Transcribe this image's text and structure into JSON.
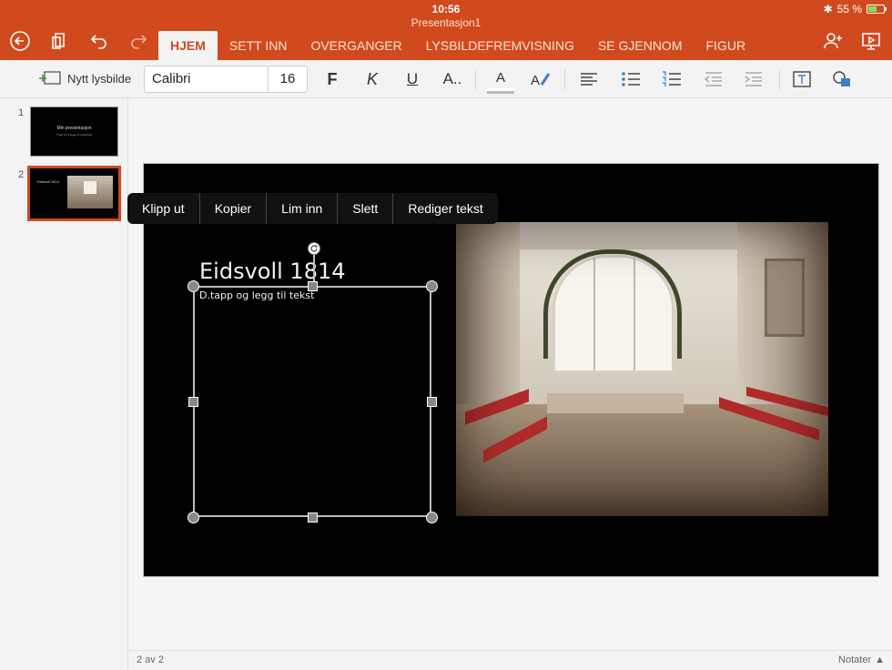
{
  "status": {
    "time": "10:56",
    "battery": "55 %",
    "battery_level": 0.55
  },
  "document": {
    "title": "Presentasjon1"
  },
  "ribbon": {
    "tabs": [
      {
        "label": "HJEM",
        "active": true
      },
      {
        "label": "SETT INN"
      },
      {
        "label": "OVERGANGER"
      },
      {
        "label": "LYSBILDEFREMVISNING"
      },
      {
        "label": "SE GJENNOM"
      },
      {
        "label": "FIGUR"
      }
    ]
  },
  "toolbar": {
    "new_slide_label": "Nytt lysbilde",
    "font_name": "Calibri",
    "font_size": "16",
    "bold_label": "F",
    "italic_label": "K",
    "underline_label": "U",
    "more_format_label": "A..",
    "font_color_label": "A"
  },
  "thumbnails": [
    {
      "number": "1",
      "title": "Min presentasjon",
      "subtitle": "Trykk for å legge til undertittel"
    },
    {
      "number": "2",
      "title": "Eidsvoll 1814"
    }
  ],
  "slide": {
    "title": "Eidsvoll 1814",
    "placeholder": "D.tapp og legg til tekst"
  },
  "context_menu": {
    "items": [
      "Klipp ut",
      "Kopier",
      "Lim inn",
      "Slett",
      "Rediger tekst"
    ]
  },
  "statusbar": {
    "page_indicator": "2 av 2",
    "notes_label": "Notater"
  },
  "colors": {
    "accent": "#d04a1e",
    "selection": "#d04a1e"
  }
}
